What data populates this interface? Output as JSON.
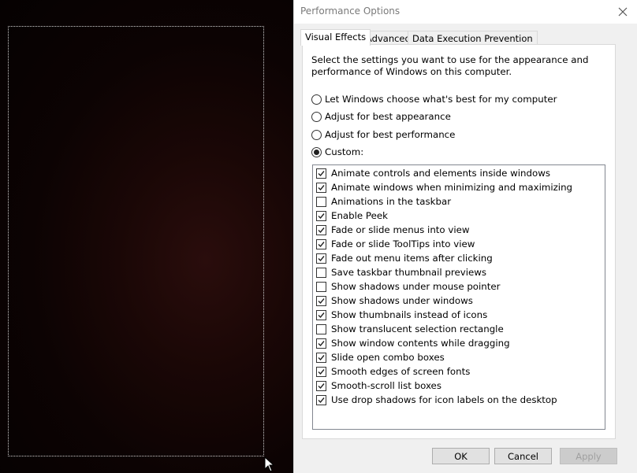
{
  "dialog": {
    "title": "Performance Options",
    "tabs": [
      {
        "label": "Visual Effects",
        "active": true
      },
      {
        "label": "Advanced",
        "active": false
      },
      {
        "label": "Data Execution Prevention",
        "active": false
      }
    ],
    "description": "Select the settings you want to use for the appearance and performance of Windows on this computer.",
    "radios": [
      {
        "label": "Let Windows choose what's best for my computer",
        "checked": false
      },
      {
        "label": "Adjust for best appearance",
        "checked": false
      },
      {
        "label": "Adjust for best performance",
        "checked": false
      },
      {
        "label": "Custom:",
        "checked": true
      }
    ],
    "options": [
      {
        "label": "Animate controls and elements inside windows",
        "checked": true
      },
      {
        "label": "Animate windows when minimizing and maximizing",
        "checked": true
      },
      {
        "label": "Animations in the taskbar",
        "checked": false
      },
      {
        "label": "Enable Peek",
        "checked": true
      },
      {
        "label": "Fade or slide menus into view",
        "checked": true
      },
      {
        "label": "Fade or slide ToolTips into view",
        "checked": true
      },
      {
        "label": "Fade out menu items after clicking",
        "checked": true
      },
      {
        "label": "Save taskbar thumbnail previews",
        "checked": false
      },
      {
        "label": "Show shadows under mouse pointer",
        "checked": false
      },
      {
        "label": "Show shadows under windows",
        "checked": true
      },
      {
        "label": "Show thumbnails instead of icons",
        "checked": true
      },
      {
        "label": "Show translucent selection rectangle",
        "checked": false
      },
      {
        "label": "Show window contents while dragging",
        "checked": true
      },
      {
        "label": "Slide open combo boxes",
        "checked": true
      },
      {
        "label": "Smooth edges of screen fonts",
        "checked": true
      },
      {
        "label": "Smooth-scroll list boxes",
        "checked": true
      },
      {
        "label": "Use drop shadows for icon labels on the desktop",
        "checked": true
      }
    ],
    "buttons": {
      "ok": "OK",
      "cancel": "Cancel",
      "apply": "Apply"
    }
  },
  "icons": {
    "close": "close-icon",
    "cursor": "mouse-pointer-icon"
  }
}
